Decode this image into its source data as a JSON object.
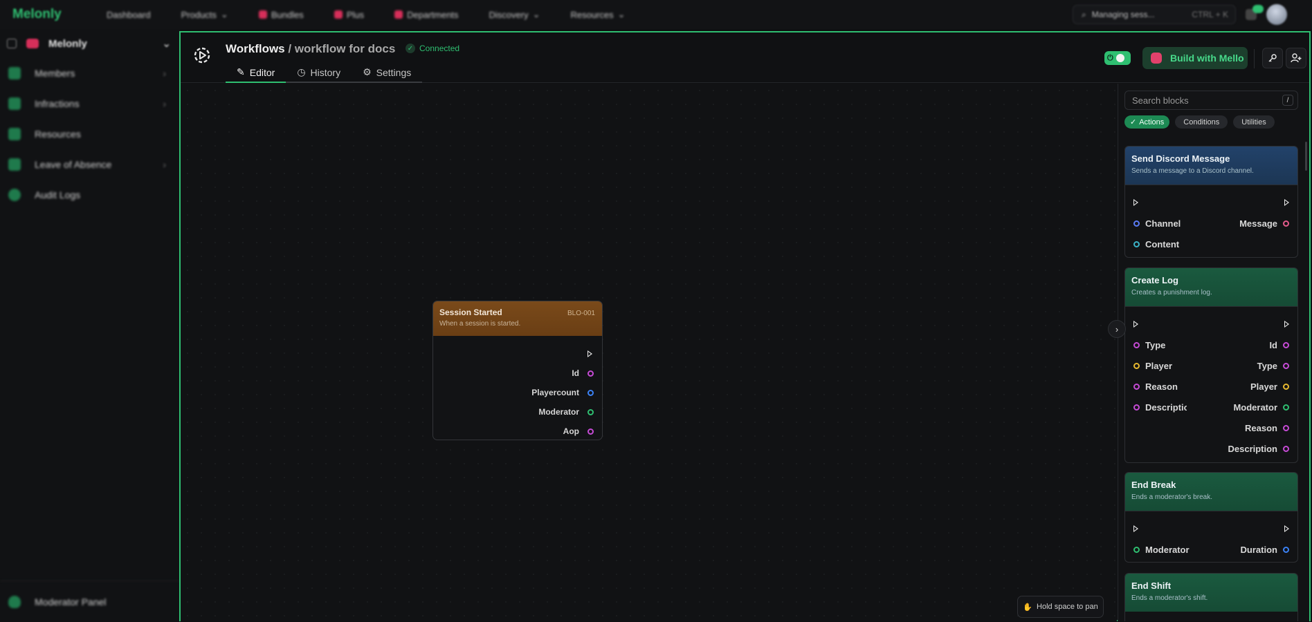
{
  "topbar": {
    "logo": "Melonly",
    "nav": [
      "Dashboard",
      "Products",
      "Bundles",
      "Plus",
      "Departments",
      "Discovery",
      "Resources"
    ],
    "search_label": "Managing sess...",
    "search_shortcut": "CTRL + K"
  },
  "sidebar": {
    "server_name": "Melonly",
    "items": [
      {
        "label": "Members"
      },
      {
        "label": "Infractions"
      },
      {
        "label": "Resources"
      },
      {
        "label": "Leave of Absence"
      },
      {
        "label": "Audit Logs"
      }
    ],
    "footer": "Moderator Panel"
  },
  "workflow": {
    "title": "Workflows",
    "separator": " / ",
    "name": "workflow for docs",
    "status": "Connected",
    "tabs": [
      {
        "label": "Editor",
        "active": true
      },
      {
        "label": "History",
        "active": false
      },
      {
        "label": "Settings",
        "active": false
      }
    ],
    "build_button": "Build with Mello"
  },
  "canvas": {
    "node": {
      "title": "Session Started",
      "id": "BLO-001",
      "description": "When a session is started.",
      "outputs": [
        {
          "label": "Id",
          "color": "#c64bd6"
        },
        {
          "label": "Playercount",
          "color": "#3b82f6"
        },
        {
          "label": "Moderator",
          "color": "#2fbf71"
        },
        {
          "label": "Aop",
          "color": "#c64bd6"
        }
      ]
    },
    "hint": "Hold space to pan"
  },
  "panel": {
    "search_placeholder": "Search blocks",
    "search_key": "/",
    "chips": [
      "Actions",
      "Conditions",
      "Utilities"
    ],
    "cards": [
      {
        "title": "Send Discord Message",
        "description": "Sends a message to a Discord channel.",
        "rows": [
          {
            "left": "Channel",
            "left_color": "#5b7cf6",
            "right": "Message",
            "right_color": "#e45b8c"
          },
          {
            "left": "Content",
            "left_color": "#3bb3c8",
            "right": "",
            "right_color": ""
          }
        ]
      },
      {
        "title": "Create Log",
        "description": "Creates a punishment log.",
        "rows": [
          {
            "left": "Type",
            "left_color": "#c64bd6",
            "right": "Id",
            "right_color": "#c64bd6"
          },
          {
            "left": "Player",
            "left_color": "#e8b92f",
            "right": "Type",
            "right_color": "#c64bd6"
          },
          {
            "left": "Reason",
            "left_color": "#c64bd6",
            "right": "Player",
            "right_color": "#e8b92f"
          },
          {
            "left": "Description",
            "left_color": "#c64bd6",
            "right": "Moderator",
            "right_color": "#2fbf71"
          },
          {
            "left": "",
            "left_color": "",
            "right": "Reason",
            "right_color": "#c64bd6"
          },
          {
            "left": "",
            "left_color": "",
            "right": "Description",
            "right_color": "#c64bd6"
          }
        ]
      },
      {
        "title": "End Break",
        "description": "Ends a moderator's break.",
        "rows": [
          {
            "left": "Moderator",
            "left_color": "#2fbf71",
            "right": "Duration",
            "right_color": "#3b82f6"
          }
        ]
      },
      {
        "title": "End Shift",
        "description": "Ends a moderator's shift.",
        "rows": []
      }
    ]
  }
}
